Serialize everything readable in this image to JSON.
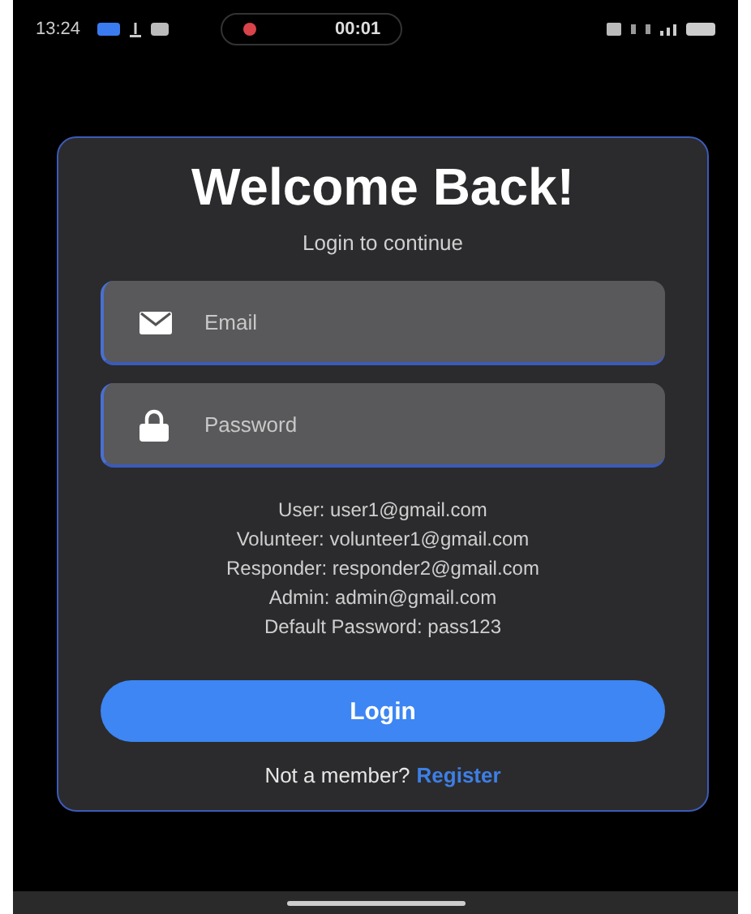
{
  "status_bar": {
    "time": "13:24",
    "recording_time": "00:01"
  },
  "login": {
    "title": "Welcome Back!",
    "subtitle": "Login to continue",
    "fields": [
      {
        "kind": "email",
        "placeholder": "Email"
      },
      {
        "kind": "password",
        "placeholder": "Password"
      }
    ],
    "credentials": [
      "User: user1@gmail.com",
      "Volunteer: volunteer1@gmail.com",
      "Responder: responder2@gmail.com",
      "Admin: admin@gmail.com",
      "Default Password: pass123"
    ],
    "button": "Login",
    "footer": "Not a member?",
    "footer_link": "Register"
  }
}
